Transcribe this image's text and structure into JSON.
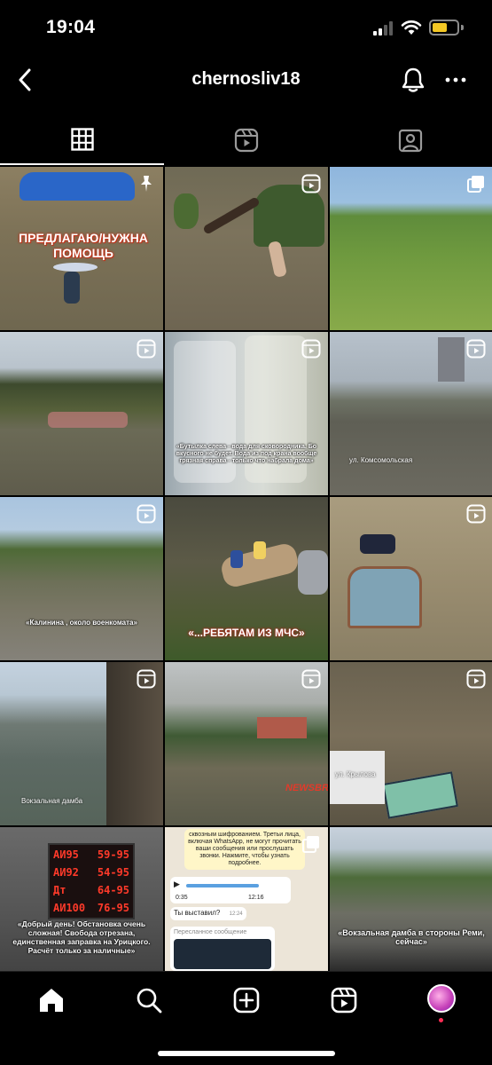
{
  "status_bar": {
    "time": "19:04"
  },
  "header": {
    "username": "chernosliv18"
  },
  "icons": {
    "back": "chevron-left-icon",
    "bell": "bell-icon",
    "more": "more-horizontal-icon",
    "grid": "grid-icon",
    "reels": "reels-icon",
    "tagged": "tagged-user-icon",
    "home": "home-icon",
    "search": "search-icon",
    "create": "plus-square-icon",
    "reels_nav": "reels-icon",
    "profile": "profile-avatar"
  },
  "grid": {
    "tiles": [
      {
        "badge": "pin",
        "headline": "ПРЕДЛАГАЮ/НУЖНА ПОМОЩЬ"
      },
      {
        "badge": "reel"
      },
      {
        "badge": "carousel"
      },
      {
        "badge": "reel"
      },
      {
        "badge": "reel",
        "caption": "«Бутылка слева - вода для сковородника. Бо вкусного не будет. Вода из под крана вообще грязная справа - только что набрала дома»"
      },
      {
        "badge": "reel",
        "location": "ул. Комсомольская"
      },
      {
        "badge": "reel",
        "caption": "«Калинина , около военкомата»"
      },
      {
        "badge": "none",
        "headline": "«...РЕБЯТАМ ИЗ МЧС»"
      },
      {
        "badge": "reel"
      },
      {
        "badge": "reel",
        "location": "Вокзальная дамба"
      },
      {
        "badge": "reel",
        "watermark": "NEWSBR"
      },
      {
        "badge": "reel",
        "location": "ул. Крылова"
      },
      {
        "badge": "none",
        "fuel": [
          {
            "name": "АИ95",
            "price": "59-95"
          },
          {
            "name": "АИ92",
            "price": "54-95"
          },
          {
            "name": "Дт",
            "price": "64-95"
          },
          {
            "name": "АИ100",
            "price": "76-95"
          }
        ],
        "caption": "«Добрый день! Обстановка очень сложная! Свобода отрезана, единственная заправка на Урицкого. Расчёт только за наличные»"
      },
      {
        "badge": "carousel",
        "chat_text": "сквозным шифрованием. Третьи лица, включая WhatsApp, не могут прочитать ваши сообщения или прослушать звонки. Нажмите, чтобы узнать подробнее.",
        "voice_time": "0:35",
        "voice_stamp": "12:16",
        "reply": "Ты выставил?",
        "reply_time": "12:24",
        "forward": "Пересланное сообщение"
      },
      {
        "badge": "none",
        "caption": "«Вокзальная дамба в стороны Реми, сейчас»"
      }
    ]
  }
}
